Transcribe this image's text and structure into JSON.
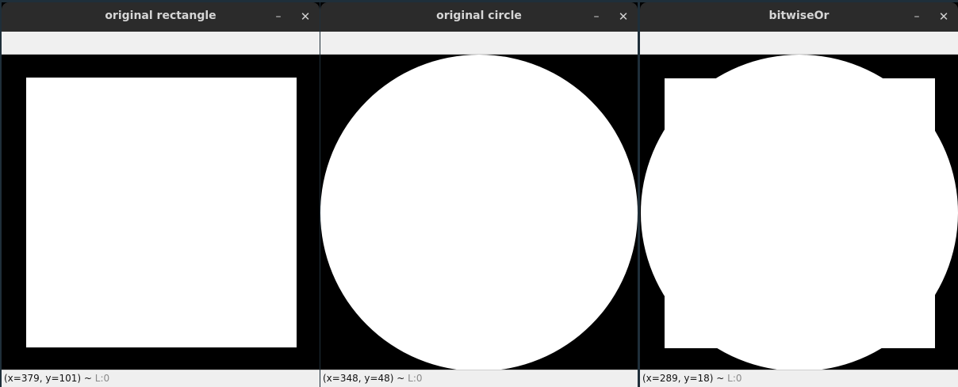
{
  "windows": [
    {
      "title": "original rectangle",
      "status_coords": "(x=379, y=101) ~ ",
      "status_level": "L:0",
      "minimize_icon": "minimize-icon",
      "close_icon": "close-icon"
    },
    {
      "title": "original circle",
      "status_coords": "(x=348, y=48) ~ ",
      "status_level": "L:0",
      "minimize_icon": "minimize-icon",
      "close_icon": "close-icon"
    },
    {
      "title": "bitwiseOr",
      "status_coords": "(x=289, y=18) ~ ",
      "status_level": "L:0",
      "minimize_icon": "minimize-icon",
      "close_icon": "close-icon"
    }
  ],
  "glyphs": {
    "minimize": "–",
    "close": "✕"
  },
  "colors": {
    "canvas": "#000000",
    "shape": "#ffffff",
    "titlebar": "#2b2b2b"
  }
}
